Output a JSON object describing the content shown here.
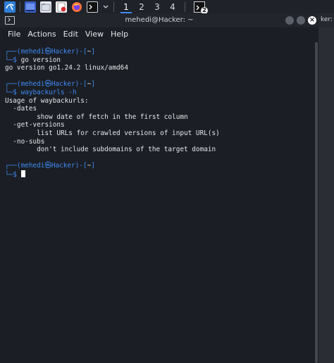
{
  "taskbar": {
    "workspaces": [
      "1",
      "2",
      "3",
      "4"
    ],
    "active_workspace": "1",
    "terminal_badge": "2",
    "accent": "#3d8bf5"
  },
  "window": {
    "title": "mehedi@Hacker: ~",
    "close_glyph": "×",
    "menu": [
      "File",
      "Actions",
      "Edit",
      "View",
      "Help"
    ]
  },
  "terminal": {
    "prompt_user": "mehedi",
    "prompt_at": "㉿",
    "prompt_host": "Hacker",
    "prompt_dir": "~",
    "commands": [
      {
        "cmd": "go version",
        "output": [
          "go version go1.24.2 linux/amd64"
        ]
      },
      {
        "cmd": "waybackurls -h",
        "output": [
          "Usage of waybackurls:",
          "  -dates",
          "        show date of fetch in the first column",
          "  -get-versions",
          "        list URLs for crawled versions of input URL(s)",
          "  -no-subs",
          "        don't include subdomains of the target domain"
        ]
      }
    ],
    "prompt_color": "#3d8bf5"
  },
  "side_window": {
    "title_fragment": "ker:"
  }
}
